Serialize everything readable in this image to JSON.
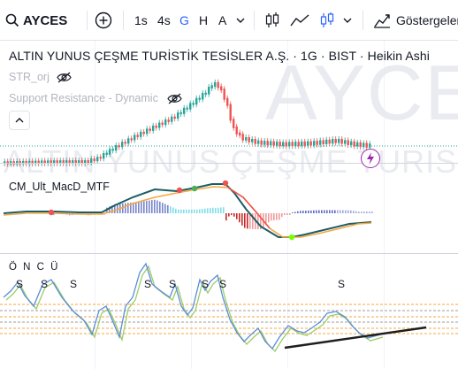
{
  "toolbar": {
    "symbol": "AYCES",
    "intervals": [
      {
        "label": "1s",
        "active": false
      },
      {
        "label": "4s",
        "active": false
      },
      {
        "label": "G",
        "active": true
      },
      {
        "label": "H",
        "active": false
      },
      {
        "label": "A",
        "active": false
      }
    ],
    "indicators_label": "Göstergeler"
  },
  "chart": {
    "watermark_symbol": "AYCES",
    "watermark_name": "ALTIN YUNUS ÇEŞME TURİSTİK TESİSLER A.Ş.",
    "title": "ALTIN YUNUS ÇEŞME TURİSTİK TESİSLER A.Ş. · 1G · BIST · Heikin Ashi",
    "indicator_1": "STR_orj",
    "indicator_2": "Support Resistance - Dynamic",
    "macd_label": "CM_Ult_MacD_MTF",
    "oncu_label": "Ö N C Ü",
    "signal_marker": "S",
    "colors": {
      "up": "#26a69a",
      "down": "#ef5350",
      "macd": "#1b5e63",
      "signal": "#f5a742",
      "osc_a": "#5b8dd9",
      "osc_b": "#9ccc65",
      "level_orange": "#f5a742",
      "trendline": "#1e1e1e",
      "accent": "#2962ff"
    }
  }
}
